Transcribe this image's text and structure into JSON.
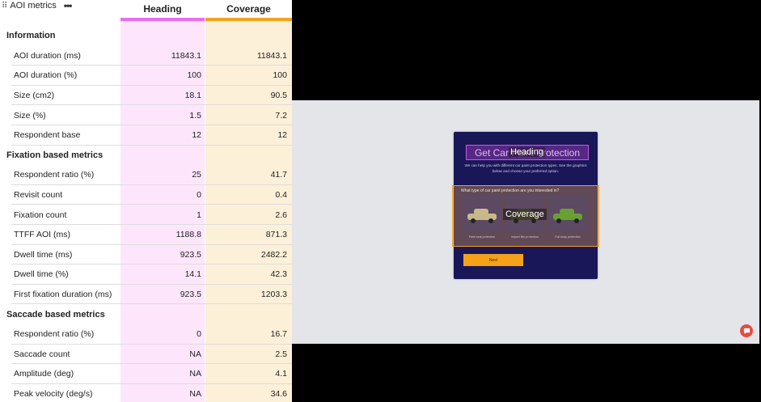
{
  "panel": {
    "title": "AOI metrics",
    "drag_icon": "drag-handle-icon",
    "more_icon": "more-options-icon",
    "columns": [
      "Heading",
      "Coverage"
    ],
    "colors": {
      "heading": "#ec6cf0",
      "heading_bg": "#fde6fc",
      "coverage": "#f3a21a",
      "coverage_bg": "#fdf0d8"
    },
    "rows": [
      {
        "label": "Information",
        "section": true
      },
      {
        "label": "AOI duration (ms)",
        "v1": "11843.1",
        "v2": "11843.1"
      },
      {
        "label": "AOI duration (%)",
        "v1": "100",
        "v2": "100"
      },
      {
        "label": "Size (cm2)",
        "v1": "18.1",
        "v2": "90.5"
      },
      {
        "label": "Size (%)",
        "v1": "1.5",
        "v2": "7.2"
      },
      {
        "label": "Respondent base",
        "v1": "12",
        "v2": "12"
      },
      {
        "label": "Fixation based metrics",
        "section": true
      },
      {
        "label": "Respondent ratio (%)",
        "v1": "25",
        "v2": "41.7"
      },
      {
        "label": "Revisit count",
        "v1": "0",
        "v2": "0.4"
      },
      {
        "label": "Fixation count",
        "v1": "1",
        "v2": "2.6"
      },
      {
        "label": "TTFF AOI (ms)",
        "v1": "1188.8",
        "v2": "871.3"
      },
      {
        "label": "Dwell time (ms)",
        "v1": "923.5",
        "v2": "2482.2"
      },
      {
        "label": "Dwell time (%)",
        "v1": "14.1",
        "v2": "42.3"
      },
      {
        "label": "First fixation duration (ms)",
        "v1": "923.5",
        "v2": "1203.3"
      },
      {
        "label": "Saccade based metrics",
        "section": true
      },
      {
        "label": "Respondent ratio (%)",
        "v1": "0",
        "v2": "16.7"
      },
      {
        "label": "Saccade count",
        "v1": "NA",
        "v2": "2.5"
      },
      {
        "label": "Amplitude (deg)",
        "v1": "NA",
        "v2": "4.1"
      },
      {
        "label": "Peak velocity (deg/s)",
        "v1": "NA",
        "v2": "34.6"
      }
    ]
  },
  "preview": {
    "card_title": "Get Car Paint Protection",
    "heading_aoi_label": "Heading",
    "card_description": "We can help you with different car paint protection types. See the graphics below and choose your preferred option.",
    "question": "What type of car paint protection are you interested in?",
    "coverage_aoi_label": "Coverage",
    "options": [
      "Paint seal protection",
      "Impact film protection",
      "Full body protection"
    ],
    "car_colors": [
      "#c9b98a",
      "#7a8a3a",
      "#6aa032"
    ],
    "next_label": "Next",
    "chat_icon": "chat-bubble-icon"
  }
}
